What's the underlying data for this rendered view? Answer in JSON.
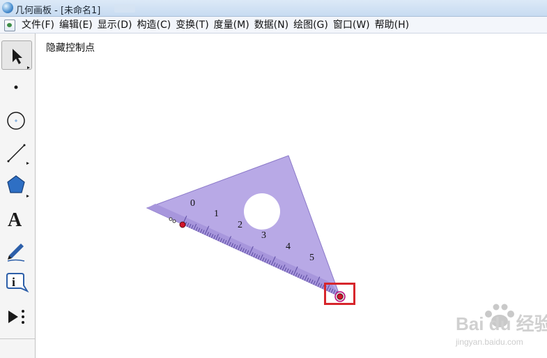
{
  "window": {
    "title": "几何画板 - [未命名1]"
  },
  "menu": {
    "items": [
      "文件(F)",
      "编辑(E)",
      "显示(D)",
      "构造(C)",
      "变换(T)",
      "度量(M)",
      "数据(N)",
      "绘图(G)",
      "窗口(W)",
      "帮助(H)"
    ]
  },
  "toolbox": {
    "tools": [
      {
        "name": "arrow-select-tool",
        "icon": "arrow-icon",
        "selected": true
      },
      {
        "name": "point-tool",
        "icon": "point-icon"
      },
      {
        "name": "compass-tool",
        "icon": "circle-icon"
      },
      {
        "name": "straightedge-tool",
        "icon": "segment-icon"
      },
      {
        "name": "polygon-tool",
        "icon": "pentagon-icon"
      },
      {
        "name": "text-tool",
        "icon": "text-a-icon",
        "glyph": "A"
      },
      {
        "name": "marker-tool",
        "icon": "pen-icon"
      },
      {
        "name": "information-tool",
        "icon": "info-icon",
        "glyph": "i"
      },
      {
        "name": "custom-tool",
        "icon": "play-more-icon"
      }
    ]
  },
  "canvas": {
    "action_label": "隐藏控制点",
    "ruler_ticks": [
      "0",
      "1",
      "2",
      "3",
      "4",
      "5"
    ]
  },
  "colors": {
    "triangle_fill": "#b8a9e6",
    "ruler_band": "#a796dc",
    "point_red": "#d2142b",
    "highlight": "#d7262c",
    "selection_fill": "#d8d8d8"
  },
  "watermark": {
    "brand": "Bai du 经验",
    "url": "jingyan.baidu.com"
  }
}
